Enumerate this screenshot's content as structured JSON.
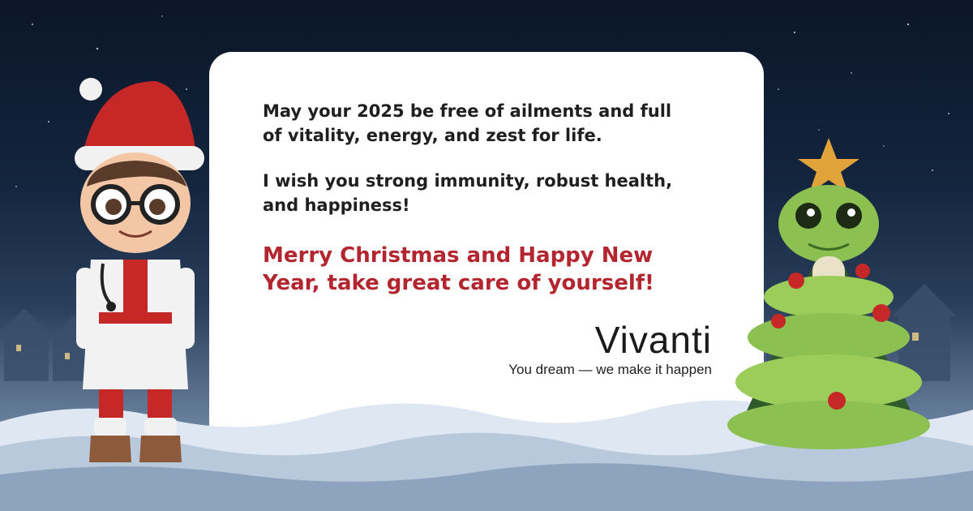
{
  "card": {
    "paragraph_1": "May your 2025 be free of ailments and full of vitality, energy, and zest for life.",
    "paragraph_2": "I wish you strong immunity, robust health, and happiness!",
    "greeting": "Merry Christmas and Happy New Year, take great care of yourself!"
  },
  "brand": {
    "logo_text": "Vivanti",
    "tagline": "You dream — we make it happen"
  },
  "illustrations": {
    "left": "doctor-character-santa-hat",
    "right": "green-snake-christmas-tree"
  },
  "colors": {
    "greeting_red": "#b3262f",
    "text_dark": "#1f1f1f",
    "card_bg": "#ffffff",
    "sky_dark": "#0b1628"
  }
}
